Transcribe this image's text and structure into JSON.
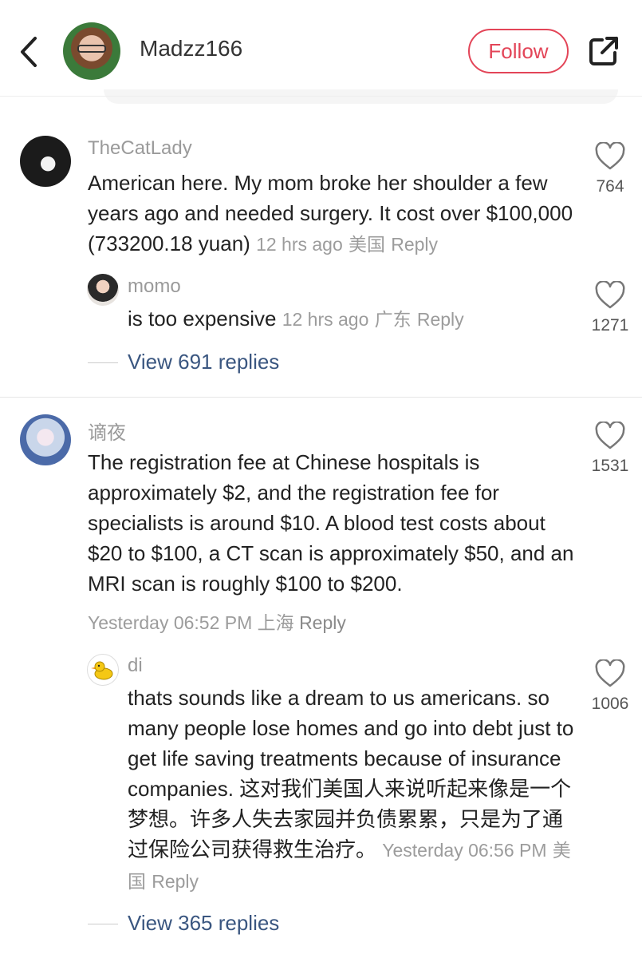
{
  "header": {
    "username": "Madzz166",
    "follow_label": "Follow"
  },
  "comments": [
    {
      "username": "TheCatLady",
      "text": "American here. My mom broke her shoulder a few years ago and needed surgery. It cost over $100,000 (733200.18 yuan)",
      "time": "12 hrs ago",
      "location": "美国",
      "reply_label": "Reply",
      "likes": "764",
      "replies": [
        {
          "username": "momo",
          "text": "is too expensive",
          "time": "12 hrs ago",
          "location": "广东",
          "reply_label": "Reply",
          "likes": "1271"
        }
      ],
      "view_replies": "View 691 replies"
    },
    {
      "username": "谪夜",
      "text": "The registration fee at Chinese hospitals is approximately $2, and the registration fee for specialists is around $10. A blood test costs about $20 to $100, a CT scan is approximately $50, and an MRI scan is roughly $100 to $200.",
      "time": "Yesterday 06:52 PM",
      "location": "上海",
      "reply_label": "Reply",
      "likes": "1531",
      "replies": [
        {
          "username": "di",
          "text": "thats sounds like a dream to us americans. so many people lose homes and go into debt just to get life saving treatments because of insurance companies. 这对我们美国人来说听起来像是一个梦想。许多人失去家园并负债累累，只是为了通过保险公司获得救生治疗。",
          "time": "Yesterday 06:56 PM",
          "location": "美国",
          "reply_label": "Reply",
          "likes": "1006"
        }
      ],
      "view_replies": "View 365 replies"
    }
  ]
}
